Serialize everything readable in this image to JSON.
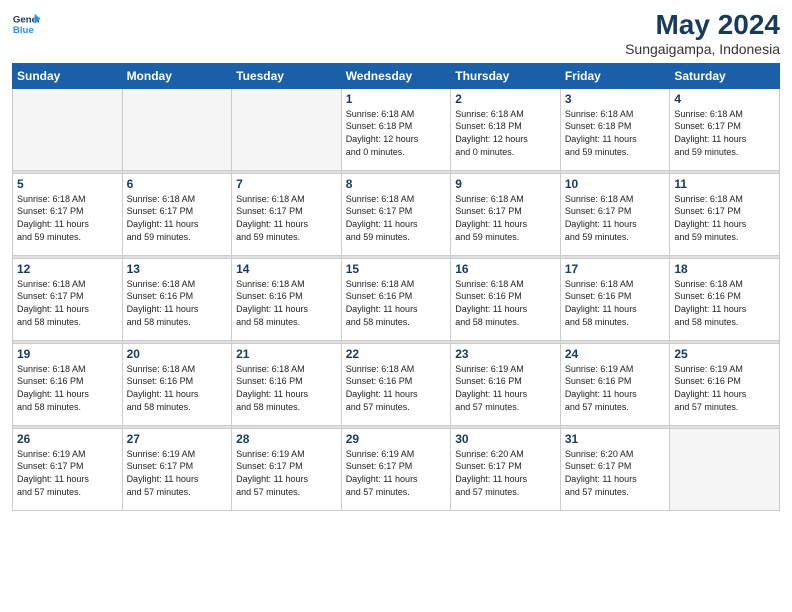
{
  "logo": {
    "line1": "General",
    "line2": "Blue"
  },
  "title": "May 2024",
  "location": "Sungaigampa, Indonesia",
  "days_header": [
    "Sunday",
    "Monday",
    "Tuesday",
    "Wednesday",
    "Thursday",
    "Friday",
    "Saturday"
  ],
  "weeks": [
    [
      {
        "num": "",
        "detail": ""
      },
      {
        "num": "",
        "detail": ""
      },
      {
        "num": "",
        "detail": ""
      },
      {
        "num": "1",
        "detail": "Sunrise: 6:18 AM\nSunset: 6:18 PM\nDaylight: 12 hours\nand 0 minutes."
      },
      {
        "num": "2",
        "detail": "Sunrise: 6:18 AM\nSunset: 6:18 PM\nDaylight: 12 hours\nand 0 minutes."
      },
      {
        "num": "3",
        "detail": "Sunrise: 6:18 AM\nSunset: 6:18 PM\nDaylight: 11 hours\nand 59 minutes."
      },
      {
        "num": "4",
        "detail": "Sunrise: 6:18 AM\nSunset: 6:17 PM\nDaylight: 11 hours\nand 59 minutes."
      }
    ],
    [
      {
        "num": "5",
        "detail": "Sunrise: 6:18 AM\nSunset: 6:17 PM\nDaylight: 11 hours\nand 59 minutes."
      },
      {
        "num": "6",
        "detail": "Sunrise: 6:18 AM\nSunset: 6:17 PM\nDaylight: 11 hours\nand 59 minutes."
      },
      {
        "num": "7",
        "detail": "Sunrise: 6:18 AM\nSunset: 6:17 PM\nDaylight: 11 hours\nand 59 minutes."
      },
      {
        "num": "8",
        "detail": "Sunrise: 6:18 AM\nSunset: 6:17 PM\nDaylight: 11 hours\nand 59 minutes."
      },
      {
        "num": "9",
        "detail": "Sunrise: 6:18 AM\nSunset: 6:17 PM\nDaylight: 11 hours\nand 59 minutes."
      },
      {
        "num": "10",
        "detail": "Sunrise: 6:18 AM\nSunset: 6:17 PM\nDaylight: 11 hours\nand 59 minutes."
      },
      {
        "num": "11",
        "detail": "Sunrise: 6:18 AM\nSunset: 6:17 PM\nDaylight: 11 hours\nand 59 minutes."
      }
    ],
    [
      {
        "num": "12",
        "detail": "Sunrise: 6:18 AM\nSunset: 6:17 PM\nDaylight: 11 hours\nand 58 minutes."
      },
      {
        "num": "13",
        "detail": "Sunrise: 6:18 AM\nSunset: 6:16 PM\nDaylight: 11 hours\nand 58 minutes."
      },
      {
        "num": "14",
        "detail": "Sunrise: 6:18 AM\nSunset: 6:16 PM\nDaylight: 11 hours\nand 58 minutes."
      },
      {
        "num": "15",
        "detail": "Sunrise: 6:18 AM\nSunset: 6:16 PM\nDaylight: 11 hours\nand 58 minutes."
      },
      {
        "num": "16",
        "detail": "Sunrise: 6:18 AM\nSunset: 6:16 PM\nDaylight: 11 hours\nand 58 minutes."
      },
      {
        "num": "17",
        "detail": "Sunrise: 6:18 AM\nSunset: 6:16 PM\nDaylight: 11 hours\nand 58 minutes."
      },
      {
        "num": "18",
        "detail": "Sunrise: 6:18 AM\nSunset: 6:16 PM\nDaylight: 11 hours\nand 58 minutes."
      }
    ],
    [
      {
        "num": "19",
        "detail": "Sunrise: 6:18 AM\nSunset: 6:16 PM\nDaylight: 11 hours\nand 58 minutes."
      },
      {
        "num": "20",
        "detail": "Sunrise: 6:18 AM\nSunset: 6:16 PM\nDaylight: 11 hours\nand 58 minutes."
      },
      {
        "num": "21",
        "detail": "Sunrise: 6:18 AM\nSunset: 6:16 PM\nDaylight: 11 hours\nand 58 minutes."
      },
      {
        "num": "22",
        "detail": "Sunrise: 6:18 AM\nSunset: 6:16 PM\nDaylight: 11 hours\nand 57 minutes."
      },
      {
        "num": "23",
        "detail": "Sunrise: 6:19 AM\nSunset: 6:16 PM\nDaylight: 11 hours\nand 57 minutes."
      },
      {
        "num": "24",
        "detail": "Sunrise: 6:19 AM\nSunset: 6:16 PM\nDaylight: 11 hours\nand 57 minutes."
      },
      {
        "num": "25",
        "detail": "Sunrise: 6:19 AM\nSunset: 6:16 PM\nDaylight: 11 hours\nand 57 minutes."
      }
    ],
    [
      {
        "num": "26",
        "detail": "Sunrise: 6:19 AM\nSunset: 6:17 PM\nDaylight: 11 hours\nand 57 minutes."
      },
      {
        "num": "27",
        "detail": "Sunrise: 6:19 AM\nSunset: 6:17 PM\nDaylight: 11 hours\nand 57 minutes."
      },
      {
        "num": "28",
        "detail": "Sunrise: 6:19 AM\nSunset: 6:17 PM\nDaylight: 11 hours\nand 57 minutes."
      },
      {
        "num": "29",
        "detail": "Sunrise: 6:19 AM\nSunset: 6:17 PM\nDaylight: 11 hours\nand 57 minutes."
      },
      {
        "num": "30",
        "detail": "Sunrise: 6:20 AM\nSunset: 6:17 PM\nDaylight: 11 hours\nand 57 minutes."
      },
      {
        "num": "31",
        "detail": "Sunrise: 6:20 AM\nSunset: 6:17 PM\nDaylight: 11 hours\nand 57 minutes."
      },
      {
        "num": "",
        "detail": ""
      }
    ]
  ]
}
